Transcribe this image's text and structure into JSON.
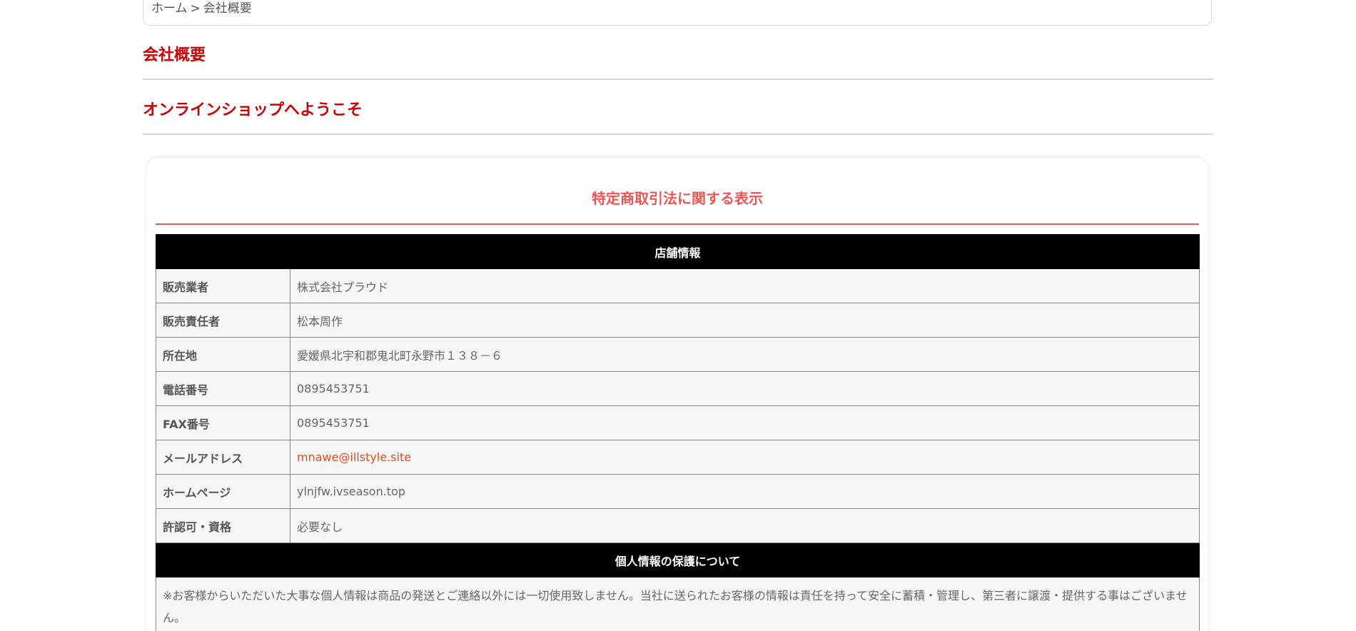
{
  "breadcrumb": {
    "home": "ホーム",
    "separator": ">",
    "current": "会社概要"
  },
  "headings": {
    "page_title": "会社概要",
    "welcome": "オンラインショップへようこそ"
  },
  "card": {
    "title": "特定商取引法に関する表示"
  },
  "store_info": {
    "section_title": "店舗情報",
    "rows": [
      {
        "label": "販売業者",
        "value": "株式会社プラウド"
      },
      {
        "label": "販売責任者",
        "value": "松本周作"
      },
      {
        "label": "所在地",
        "value": "愛媛県北宇和郡鬼北町永野市１３８－６"
      },
      {
        "label": "電話番号",
        "value": "0895453751"
      },
      {
        "label": "FAX番号",
        "value": "0895453751"
      },
      {
        "label": "メールアドレス",
        "value": "mnawe@illstyle.site"
      },
      {
        "label": "ホームページ",
        "value": "ylnjfw.ivseason.top"
      },
      {
        "label": "許認可・資格",
        "value": "必要なし"
      }
    ]
  },
  "privacy": {
    "section_title": "個人情報の保護について",
    "text": "※お客様からいただいた大事な個人情報は商品の発送とご連絡以外には一切使用致しません。当社に送られたお客様の情報は責任を持って安全に蓄積・管理し、第三者に譲渡・提供する事はございません。"
  },
  "colors": {
    "heading_red": "#cc0000",
    "card_title_red": "#ee5555",
    "link_orange": "#e64a19",
    "section_header_bg": "#000000"
  }
}
